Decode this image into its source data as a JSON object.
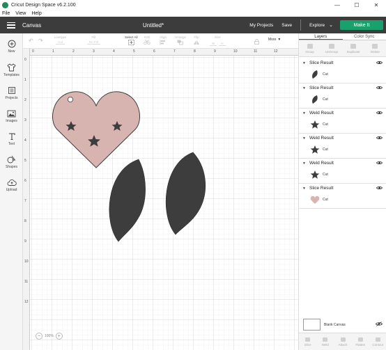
{
  "window": {
    "title": "Cricut Design Space  v6.2.100",
    "controls": [
      "minimize",
      "maximize",
      "close"
    ]
  },
  "menu": [
    "File",
    "View",
    "Help"
  ],
  "header": {
    "section": "Canvas",
    "document_title": "Untitled*",
    "my_projects": "My Projects",
    "save": "Save",
    "explore": "Explore",
    "make_it": "Make It",
    "make_it_color": "#1aa06d"
  },
  "leftnav": [
    {
      "label": "New",
      "icon": "plus-circle-icon"
    },
    {
      "label": "Templates",
      "icon": "shirt-icon"
    },
    {
      "label": "Projects",
      "icon": "projects-icon"
    },
    {
      "label": "Images",
      "icon": "image-icon"
    },
    {
      "label": "Text",
      "icon": "text-t-icon"
    },
    {
      "label": "Shapes",
      "icon": "shapes-icon"
    },
    {
      "label": "Upload",
      "icon": "upload-cloud-icon"
    }
  ],
  "toolbar": {
    "linetype": {
      "label": "Linetype",
      "value": "Cut"
    },
    "fill": {
      "label": "Fill",
      "value": "No Fill"
    },
    "select_all": "Select All",
    "edit": "Edit",
    "align": "Align",
    "arrange": "Arrange",
    "flip": "Flip",
    "size": "Size",
    "size_w": "W",
    "size_h": "H",
    "more": "More"
  },
  "ruler": {
    "top": [
      "0",
      "1",
      "2",
      "3",
      "4",
      "5",
      "6",
      "7",
      "8",
      "9",
      "10",
      "11",
      "12"
    ],
    "left": [
      "0",
      "1",
      "2",
      "3",
      "4",
      "5",
      "6",
      "7",
      "8",
      "9",
      "10",
      "11",
      "12"
    ]
  },
  "zoom": {
    "value": "100%"
  },
  "right_panel": {
    "tabs": [
      "Layers",
      "Color Sync"
    ],
    "actions": [
      "Group",
      "UnGroup",
      "Duplicate",
      "Delete"
    ],
    "layers": [
      {
        "title": "Slice Result",
        "operation": "Cut",
        "shape": "teardrop",
        "color": "#3d3d3d"
      },
      {
        "title": "Slice Result",
        "operation": "Cut",
        "shape": "teardrop",
        "color": "#3d3d3d"
      },
      {
        "title": "Weld Result",
        "operation": "Cut",
        "shape": "star",
        "color": "#3d3d3d"
      },
      {
        "title": "Weld Result",
        "operation": "Cut",
        "shape": "star",
        "color": "#3d3d3d"
      },
      {
        "title": "Weld Result",
        "operation": "Cut",
        "shape": "star",
        "color": "#3d3d3d"
      },
      {
        "title": "Slice Result",
        "operation": "Cut",
        "shape": "heart",
        "color": "#d8b4b1"
      }
    ],
    "blank_canvas": "Blank Canvas",
    "bottom_actions": [
      "Slice",
      "Weld",
      "Attach",
      "Flatten",
      "Contour"
    ]
  },
  "canvas_objects": [
    {
      "name": "heart",
      "color": "#d8b4b1"
    },
    {
      "name": "star",
      "color": "#3d3d3d"
    },
    {
      "name": "teardrop",
      "color": "#3d3d3d"
    }
  ]
}
